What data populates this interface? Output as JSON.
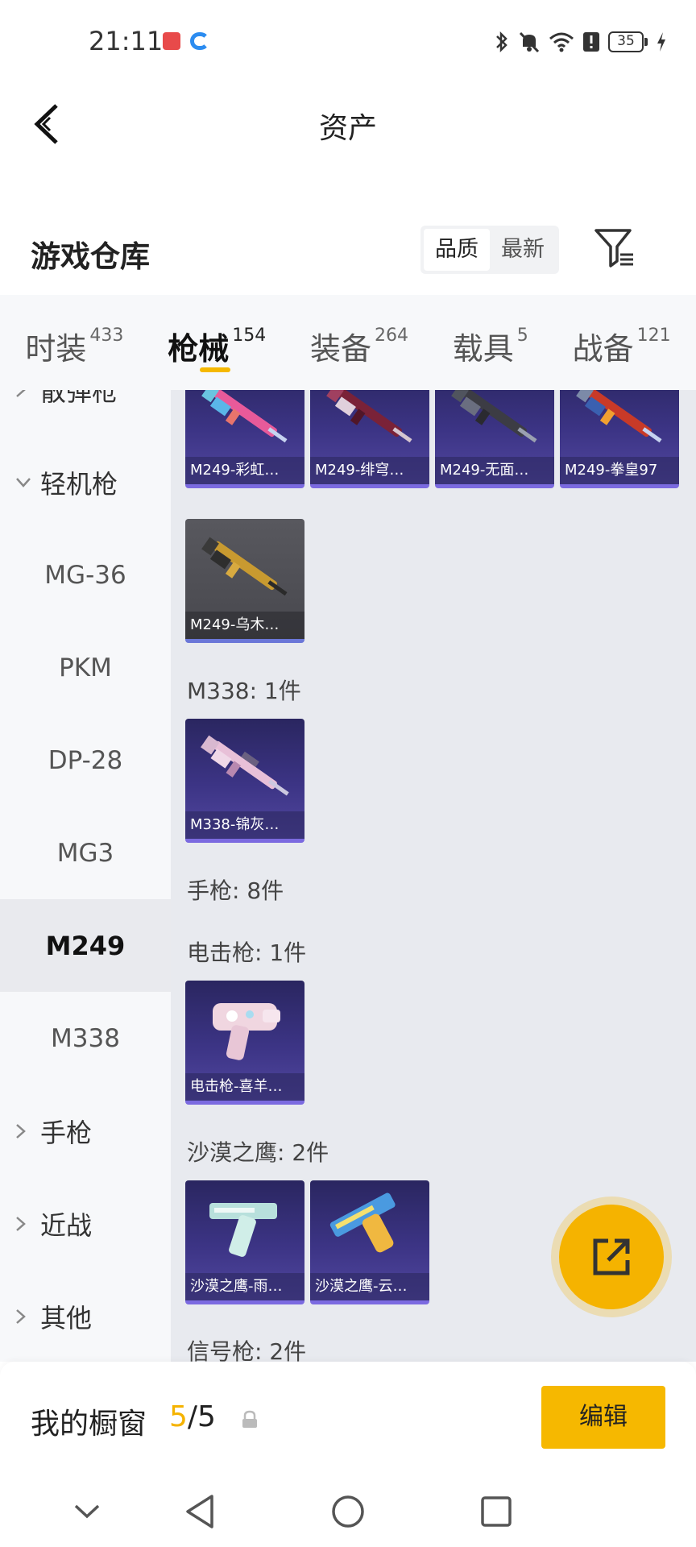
{
  "status_bar": {
    "time": "21:11",
    "battery": "35"
  },
  "header": {
    "title": "资产"
  },
  "section": {
    "title": "游戏仓库",
    "sort_options": [
      "品质",
      "最新"
    ],
    "active_sort": "品质"
  },
  "tabs": [
    {
      "label": "时装",
      "count": "433"
    },
    {
      "label": "枪械",
      "count": "154",
      "active": true
    },
    {
      "label": "装备",
      "count": "264"
    },
    {
      "label": "载具",
      "count": "5"
    },
    {
      "label": "战备",
      "count": "121"
    }
  ],
  "sidebar": {
    "items": [
      {
        "label": "散弹枪",
        "kind": "parent"
      },
      {
        "label": "轻机枪",
        "kind": "parent",
        "expanded": true
      },
      {
        "label": "MG-36",
        "kind": "child"
      },
      {
        "label": "PKM",
        "kind": "child"
      },
      {
        "label": "DP-28",
        "kind": "child"
      },
      {
        "label": "MG3",
        "kind": "child"
      },
      {
        "label": "M249",
        "kind": "child",
        "selected": true
      },
      {
        "label": "M338",
        "kind": "child"
      },
      {
        "label": "手枪",
        "kind": "parent"
      },
      {
        "label": "近战",
        "kind": "parent"
      },
      {
        "label": "其他",
        "kind": "parent"
      }
    ]
  },
  "content": {
    "m249_cards": [
      "M249-彩虹…",
      "M249-绯穹…",
      "M249-无面…",
      "M249-拳皇97",
      "M249-乌木…"
    ],
    "group_m338": "M338: 1件",
    "m338_cards": [
      "M338-锦灰…"
    ],
    "group_pistol": "手枪: 8件",
    "group_shock": "电击枪: 1件",
    "shock_cards": [
      "电击枪-喜羊…"
    ],
    "group_deagle": "沙漠之鹰: 2件",
    "deagle_cards": [
      "沙漠之鹰-雨…",
      "沙漠之鹰-云…"
    ],
    "group_flare": "信号枪: 2件"
  },
  "bottom_bar": {
    "label": "我的橱窗",
    "current": "5",
    "separator": "/",
    "max": "5",
    "edit_label": "编辑"
  },
  "colors": {
    "accent": "#f5b300",
    "card_purple": "#3c3485",
    "card_grey": "#4e4e54",
    "content_bg": "#e8eaef"
  }
}
